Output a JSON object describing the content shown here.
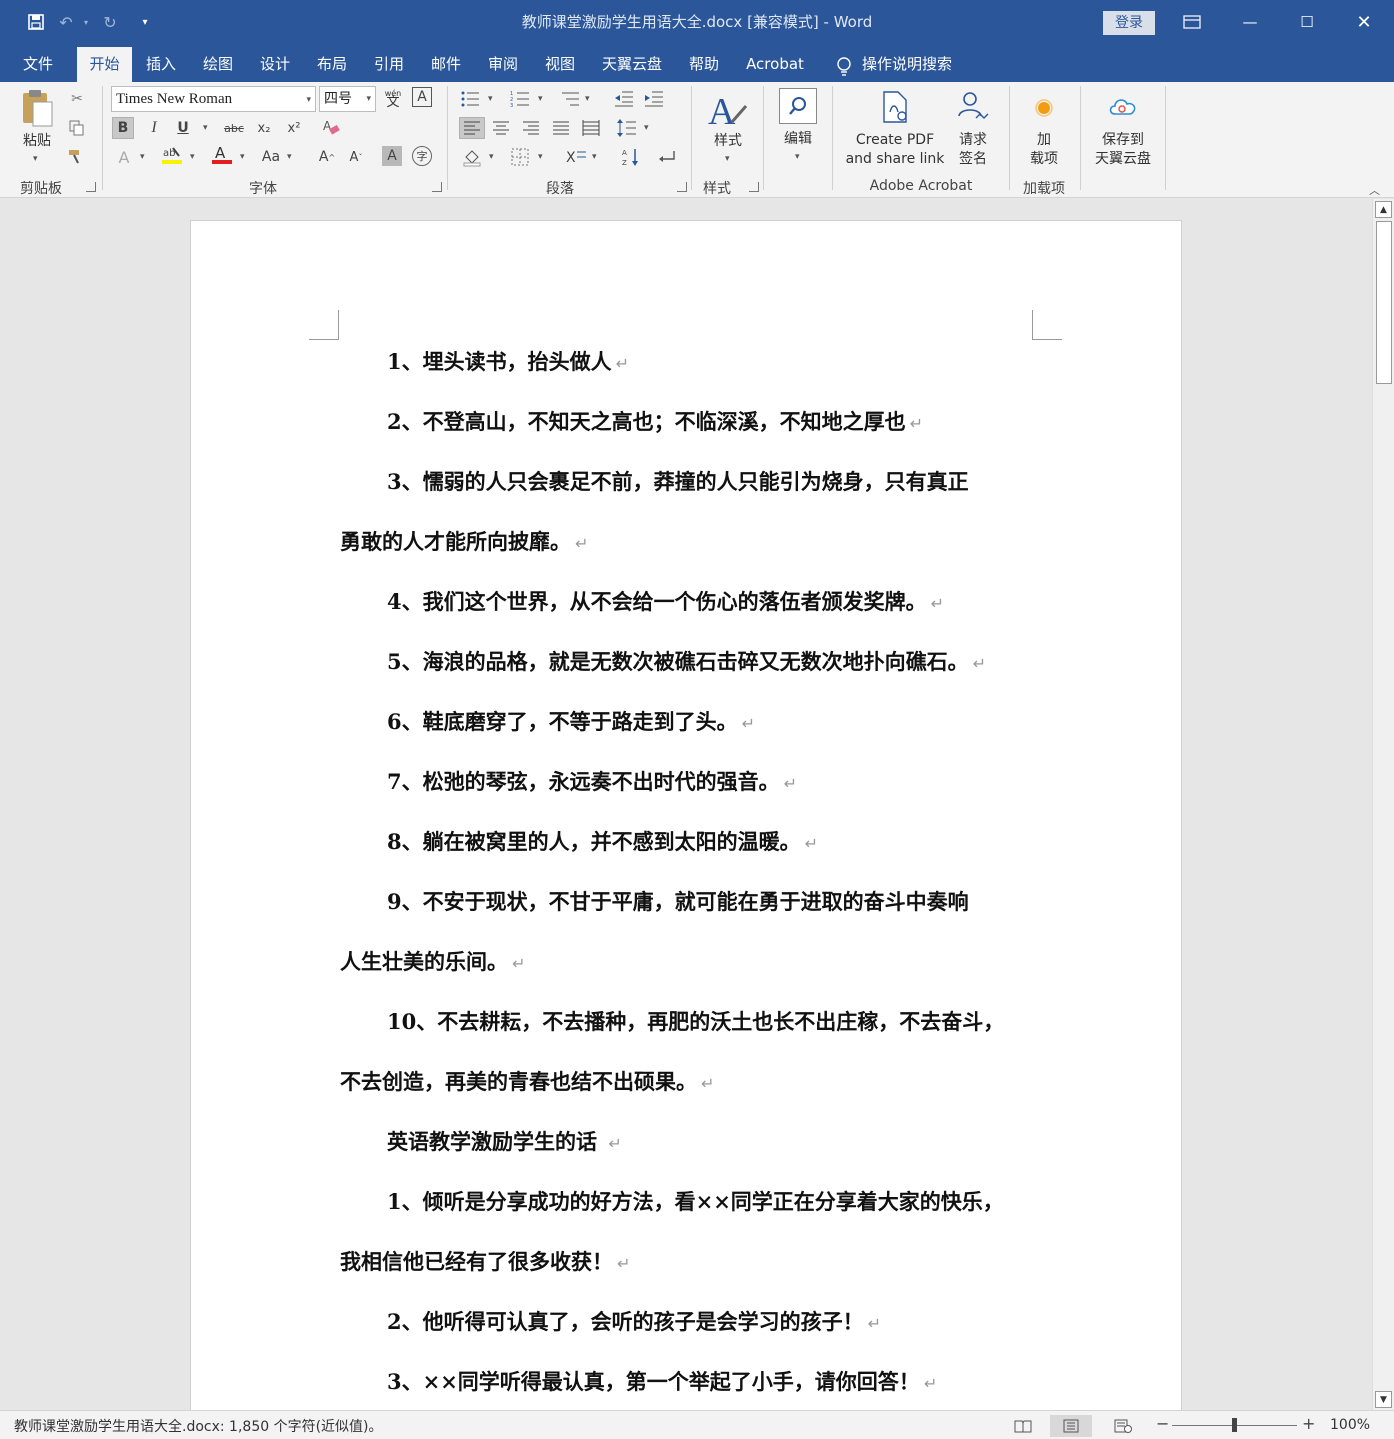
{
  "window": {
    "title": "教师课堂激励学生用语大全.docx [兼容模式]  -  Word",
    "login_label": "登录"
  },
  "tabs": [
    {
      "label": "文件"
    },
    {
      "label": "开始"
    },
    {
      "label": "插入"
    },
    {
      "label": "绘图"
    },
    {
      "label": "设计"
    },
    {
      "label": "布局"
    },
    {
      "label": "引用"
    },
    {
      "label": "邮件"
    },
    {
      "label": "审阅"
    },
    {
      "label": "视图"
    },
    {
      "label": "天翼云盘"
    },
    {
      "label": "帮助"
    },
    {
      "label": "Acrobat"
    }
  ],
  "search_label": "操作说明搜索",
  "ribbon": {
    "clipboard": {
      "paste_label": "粘贴",
      "group_label": "剪贴板"
    },
    "font": {
      "font_name": "Times New Roman",
      "font_size": "四号",
      "group_label": "字体",
      "wen_label": "wén"
    },
    "paragraph": {
      "group_label": "段落"
    },
    "styles": {
      "styles_label": "样式",
      "group_label": "样式"
    },
    "editing": {
      "edit_label": "编辑"
    },
    "acrobat": {
      "create_pdf_line1": "Create PDF",
      "create_pdf_line2": "and share link",
      "request_sign_line1": "请求",
      "request_sign_line2": "签名",
      "group_label": "Adobe Acrobat"
    },
    "addins": {
      "line1": "加",
      "line2": "载项",
      "group_label": "加载项"
    },
    "cloud": {
      "line1": "保存到",
      "line2": "天翼云盘"
    }
  },
  "document": {
    "paragraphs": [
      {
        "text": "1、埋头读书，抬头做人",
        "indent": true
      },
      {
        "text": "2、不登高山，不知天之高也；不临深溪，不知地之厚也",
        "indent": true
      },
      {
        "text": "3、懦弱的人只会裹足不前，莽撞的人只能引为烧身，只有真正",
        "indent": true,
        "no_mark": true
      },
      {
        "text": "勇敢的人才能所向披靡。",
        "indent": false
      },
      {
        "text": "4、我们这个世界，从不会给一个伤心的落伍者颁发奖牌。",
        "indent": true
      },
      {
        "text": "5、海浪的品格，就是无数次被礁石击碎又无数次地扑向礁石。",
        "indent": true
      },
      {
        "text": "6、鞋底磨穿了，不等于路走到了头。",
        "indent": true
      },
      {
        "text": "7、松弛的琴弦，永远奏不出时代的强音。",
        "indent": true
      },
      {
        "text": "8、躺在被窝里的人，并不感到太阳的温暖。",
        "indent": true
      },
      {
        "text": "9、不安于现状，不甘于平庸，就可能在勇于进取的奋斗中奏响",
        "indent": true,
        "no_mark": true
      },
      {
        "text": "人生壮美的乐间。",
        "indent": false
      },
      {
        "text": "10、不去耕耘，不去播种，再肥的沃土也长不出庄稼，不去奋斗，",
        "indent": true,
        "no_mark": true
      },
      {
        "text": "不去创造，再美的青春也结不出硕果。",
        "indent": false
      },
      {
        "text": "英语教学激励学生的话 ",
        "indent": true
      },
      {
        "text": "1、倾听是分享成功的好方法，看××同学正在分享着大家的快乐，",
        "indent": true,
        "no_mark": true
      },
      {
        "text": "我相信他已经有了很多收获！",
        "indent": false
      },
      {
        "text": "2、他听得可认真了，会听的孩子是会学习的孩子！",
        "indent": true
      },
      {
        "text": "3、××同学听得最认真，第一个举起了小手，请你回答！",
        "indent": true
      }
    ],
    "para_mark": "↵"
  },
  "status": {
    "text": "教师课堂激励学生用语大全.docx: 1,850 个字符(近似值)。",
    "zoom": "100%"
  },
  "colors": {
    "accent": "#2b579a"
  }
}
